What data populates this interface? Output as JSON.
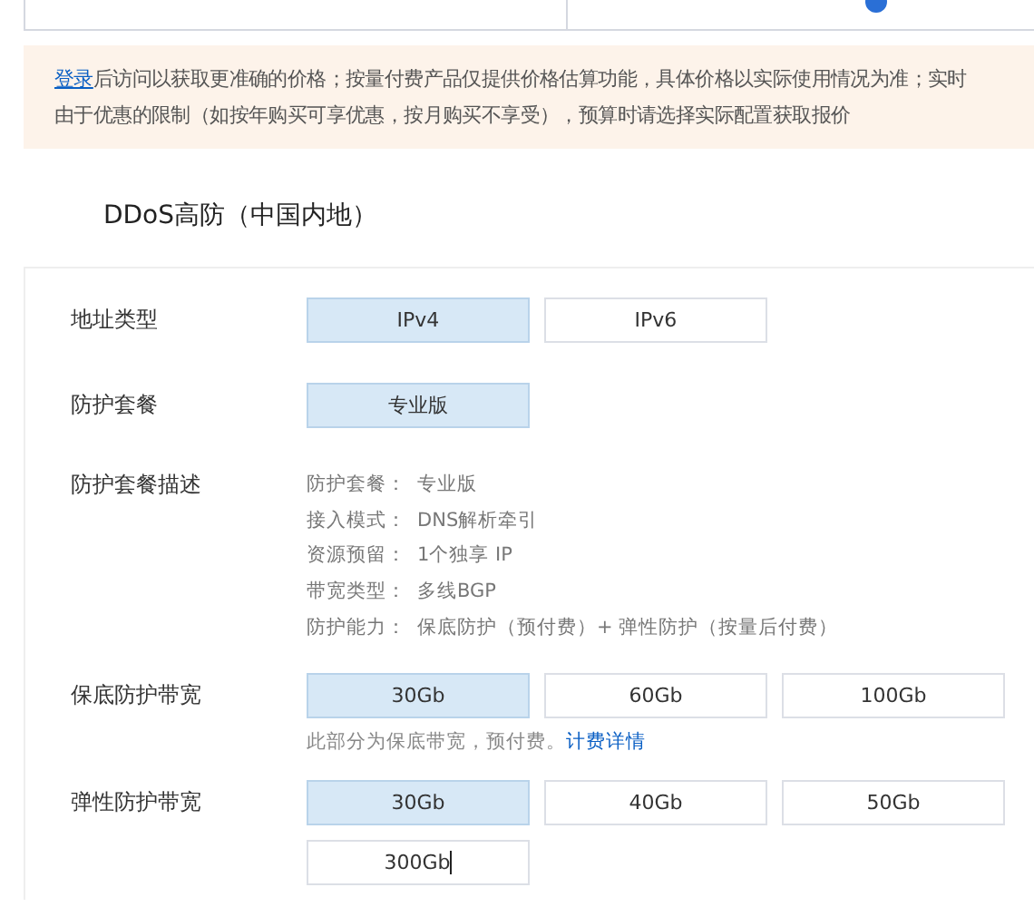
{
  "notice": {
    "link": "登录",
    "line_1": "后访问以获取更准确的价格；按量付费产品仅提供价格估算功能，具体价格以实际使用情况为准；实时",
    "line_2": "由于优惠的限制（如按年购买可享优惠，按月购买不享受），预算时请选择实际配置获取报价"
  },
  "title": "DDoS高防（中国内地）",
  "rows": [
    {
      "kind": "options",
      "label": "地址类型",
      "options": [
        {
          "label": "IPv4",
          "selected": true
        },
        {
          "label": "IPv6",
          "selected": false
        }
      ]
    },
    {
      "kind": "options",
      "label": "防护套餐",
      "options": [
        {
          "label": "专业版",
          "selected": true
        }
      ]
    },
    {
      "kind": "description",
      "label": "防护套餐描述",
      "lines": [
        {
          "key": "防护套餐：",
          "value": "专业版"
        },
        {
          "key": "接入模式：",
          "value": "DNS解析牵引"
        },
        {
          "key": "资源预留：",
          "value": "1个独享 IP"
        },
        {
          "key": "带宽类型：",
          "value": "多线BGP"
        },
        {
          "key": "防护能力：",
          "value": "保底防护（预付费）+ 弹性防护（按量后付费）"
        }
      ]
    },
    {
      "kind": "options",
      "label": "保底防护带宽",
      "options": [
        {
          "label": "30Gb",
          "selected": true
        },
        {
          "label": "60Gb",
          "selected": false
        },
        {
          "label": "100Gb",
          "selected": false
        }
      ],
      "note": "此部分为保底带宽，预付费。",
      "note_link": "计费详情"
    },
    {
      "kind": "options",
      "label": "弹性防护带宽",
      "options": [
        {
          "label": "30Gb",
          "selected": true
        },
        {
          "label": "40Gb",
          "selected": false
        },
        {
          "label": "50Gb",
          "selected": false
        }
      ],
      "input": "300Gb"
    }
  ]
}
